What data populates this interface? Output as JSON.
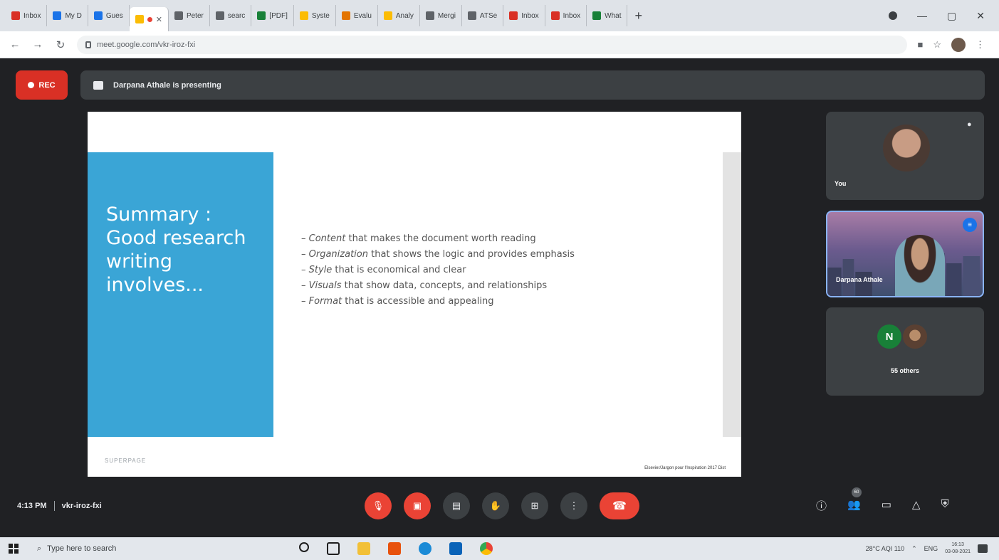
{
  "browser": {
    "tabs": [
      {
        "label": "Inbox",
        "favicon_color": "#d93025"
      },
      {
        "label": "My D",
        "favicon_color": "#1a73e8"
      },
      {
        "label": "Gues",
        "favicon_color": "#1a73e8"
      },
      {
        "label": "",
        "favicon_color": "#fbbc04",
        "active": true
      },
      {
        "label": "Peter",
        "favicon_color": "#5f6368"
      },
      {
        "label": "searc",
        "favicon_color": "#5f6368"
      },
      {
        "label": "[PDF]",
        "favicon_color": "#188038"
      },
      {
        "label": "Syste",
        "favicon_color": "#fbbc04"
      },
      {
        "label": "Evalu",
        "favicon_color": "#e37400"
      },
      {
        "label": "Analy",
        "favicon_color": "#fbbc04"
      },
      {
        "label": "Mergi",
        "favicon_color": "#5f6368"
      },
      {
        "label": "ATSe",
        "favicon_color": "#5f6368"
      },
      {
        "label": "Inbox",
        "favicon_color": "#d93025"
      },
      {
        "label": "Inbox",
        "favicon_color": "#d93025"
      },
      {
        "label": "What",
        "favicon_color": "#188038"
      }
    ],
    "new_tab": "+",
    "url": "meet.google.com/vkr-iroz-fxi"
  },
  "meet": {
    "rec_label": "REC",
    "presenting_text": "Darpana Athale is presenting",
    "time": "4:13 PM",
    "meeting_code": "vkr-iroz-fxi",
    "participants_count": "60",
    "tiles": [
      {
        "name": "You"
      },
      {
        "name": "Darpana Athale"
      },
      {
        "name": "55 others",
        "initial": "N"
      }
    ]
  },
  "slide": {
    "title_lines": [
      "Summary :",
      "Good research",
      "writing",
      "involves..."
    ],
    "bullets": [
      {
        "em": "Content",
        "rest": " that makes the document worth reading"
      },
      {
        "em": "Organization",
        "rest": " that shows the logic and provides emphasis"
      },
      {
        "em": "Style",
        "rest": " that is economical and clear"
      },
      {
        "em": "Visuals",
        "rest": " that show data, concepts, and relationships"
      },
      {
        "em": "Format",
        "rest": " that is accessible and appealing"
      }
    ],
    "logo_text": "SUPERPAGE",
    "credit_text": "Elsevier/Jargon pour l'Inspiration 2017 Dist"
  },
  "taskbar": {
    "search_placeholder": "Type here to search",
    "weather": "28°C AQI 110",
    "language": "ENG",
    "clock_time": "16:13",
    "clock_date": "03-08-2021"
  },
  "colors": {
    "meet_bg": "#202124",
    "slide_accent": "#3aa5d6",
    "record_red": "#d93025",
    "end_call_red": "#ea4335"
  }
}
